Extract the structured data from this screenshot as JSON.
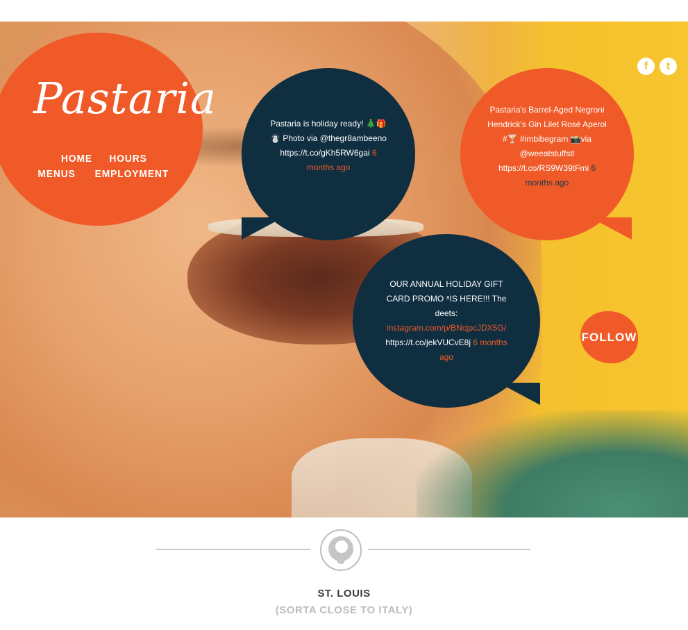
{
  "brand": {
    "logo_text": "Pastaria"
  },
  "nav": {
    "items": [
      "HOME",
      "HOURS",
      "MENUS",
      "EMPLOYMENT"
    ]
  },
  "social": {
    "facebook": "f",
    "twitter": "t",
    "facebook_icon": "facebook-icon",
    "twitter_icon": "twitter-icon"
  },
  "tweets": [
    {
      "text": "Pastaria is holiday ready! 🎄🎁☃️ Photo via @thegr8ambeeno https://t.co/gKh5RW6gai",
      "ago": "6 months ago"
    },
    {
      "text": "Pastaria's Barrel-Aged Negroni Hendrick's Gin Lilet Rosé Aperol #🍸 #imbibegram 📸via @weeatstuffstl https://t.co/RS9W39tFmi",
      "ago": "6 months ago"
    },
    {
      "text_before_link": "OUR ANNUAL HOLIDAY GIFT CARD PROMO ⁸IS HERE!!! The deets: ",
      "link": "instagram.com/p/BNcjpcJDX5G/",
      "text_after_link": " https://t.co/jekVUCvE8j",
      "ago": "6 months ago"
    }
  ],
  "follow": {
    "label": "FOLLOW"
  },
  "footer": {
    "city": "ST. LOUIS",
    "tagline": "(SORTA CLOSE TO ITALY)",
    "emblem_icon": "lion-emblem-icon"
  },
  "colors": {
    "orange": "#f05a28",
    "navy": "#0f2e40",
    "yellow": "#f5c12e"
  }
}
